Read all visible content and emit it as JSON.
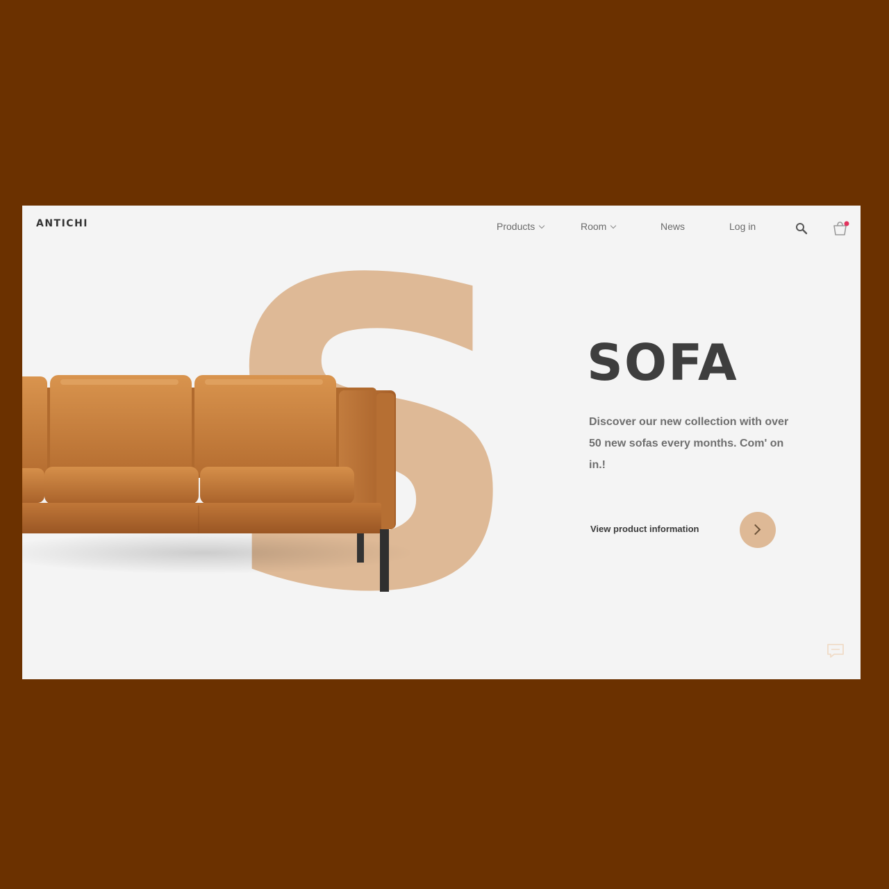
{
  "header": {
    "logo": "ANTICHI",
    "nav": [
      {
        "label": "Products",
        "has_dropdown": true
      },
      {
        "label": "Room",
        "has_dropdown": true
      },
      {
        "label": "News",
        "has_dropdown": false
      },
      {
        "label": "Log in",
        "has_dropdown": false
      }
    ],
    "icons": [
      "search-icon",
      "cart-icon"
    ],
    "cart_badge_color": "#e2335e"
  },
  "hero": {
    "big_letter": "S",
    "title": "SOFA",
    "description": "Discover our new collection with over 50 new sofas every months. Com' on in.!",
    "cta_label": "View product information",
    "cta_icon": "chevron-right-icon",
    "accent_color": "#deb996",
    "image": "tan-leather-sofa"
  },
  "footer": {
    "icons": [
      "chat-icon"
    ]
  },
  "colors": {
    "outer_background": "#6b3100",
    "page_background": "#f4f4f4",
    "sofa_leather": "#c27c3e"
  }
}
